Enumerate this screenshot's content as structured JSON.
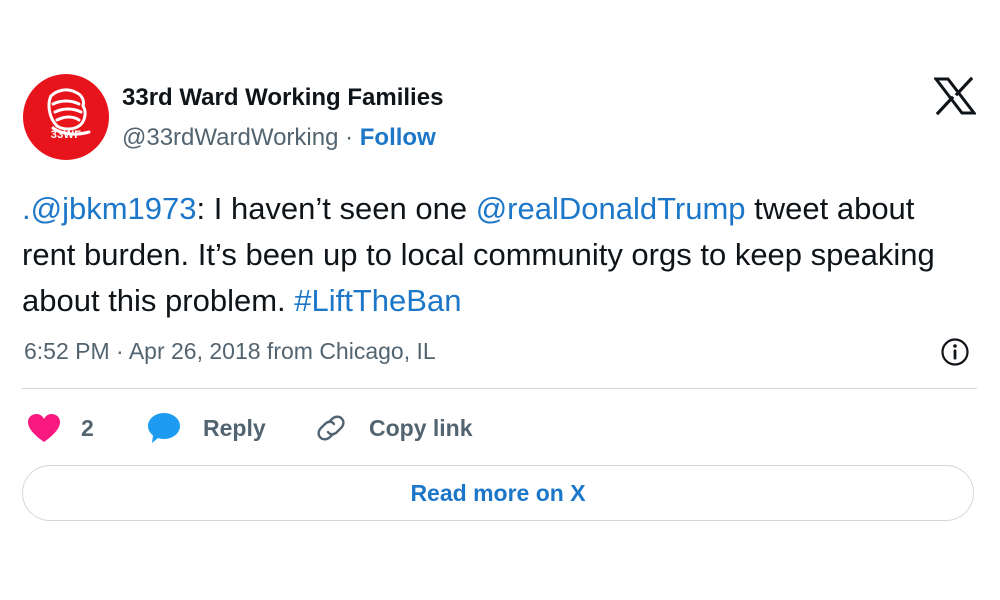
{
  "author": {
    "avatar_text": "33WF",
    "name": "33rd Ward Working Families",
    "handle": "@33rdWardWorking",
    "separator": " · ",
    "follow_label": "Follow"
  },
  "tweet": {
    "parts": [
      {
        "text": ".@jbkm1973",
        "link": true
      },
      {
        "text": ": I haven’t seen one ",
        "link": false
      },
      {
        "text": "@realDonaldTrump",
        "link": true
      },
      {
        "text": " tweet about rent burden. It’s been up to local community orgs to keep speaking about this problem. ",
        "link": false
      },
      {
        "text": "#LiftTheBan",
        "link": true
      }
    ],
    "timestamp": "6:52 PM · Apr 26, 2018 from Chicago, IL"
  },
  "actions": {
    "like_count": "2",
    "reply_label": "Reply",
    "copy_label": "Copy link"
  },
  "read_more_label": "Read more on X",
  "colors": {
    "link": "#1d77c9",
    "heart": "#f91880",
    "reply_bubble": "#1d9bf0",
    "avatar_bg": "#e8141c"
  },
  "icons": [
    "x-logo-icon",
    "info-icon",
    "heart-icon",
    "reply-bubble-icon",
    "link-icon"
  ]
}
